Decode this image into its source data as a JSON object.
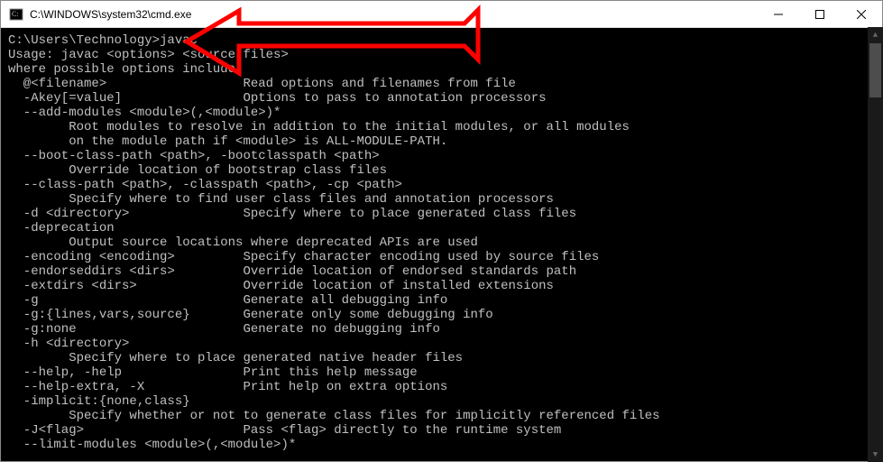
{
  "window": {
    "title": "C:\\WINDOWS\\system32\\cmd.exe"
  },
  "terminal": {
    "lines": [
      "",
      "C:\\Users\\Technology>javac",
      "Usage: javac <options> <source files>",
      "where possible options include:",
      "  @<filename>                  Read options and filenames from file",
      "  -Akey[=value]                Options to pass to annotation processors",
      "  --add-modules <module>(,<module>)*",
      "        Root modules to resolve in addition to the initial modules, or all modules",
      "        on the module path if <module> is ALL-MODULE-PATH.",
      "  --boot-class-path <path>, -bootclasspath <path>",
      "        Override location of bootstrap class files",
      "  --class-path <path>, -classpath <path>, -cp <path>",
      "        Specify where to find user class files and annotation processors",
      "  -d <directory>               Specify where to place generated class files",
      "  -deprecation",
      "        Output source locations where deprecated APIs are used",
      "  -encoding <encoding>         Specify character encoding used by source files",
      "  -endorseddirs <dirs>         Override location of endorsed standards path",
      "  -extdirs <dirs>              Override location of installed extensions",
      "  -g                           Generate all debugging info",
      "  -g:{lines,vars,source}       Generate only some debugging info",
      "  -g:none                      Generate no debugging info",
      "  -h <directory>",
      "        Specify where to place generated native header files",
      "  --help, -help                Print this help message",
      "  --help-extra, -X             Print help on extra options",
      "  -implicit:{none,class}",
      "        Specify whether or not to generate class files for implicitly referenced files",
      "  -J<flag>                     Pass <flag> directly to the runtime system",
      "  --limit-modules <module>(,<module>)*"
    ]
  },
  "annotation": {
    "arrow_color": "#ff0000"
  }
}
